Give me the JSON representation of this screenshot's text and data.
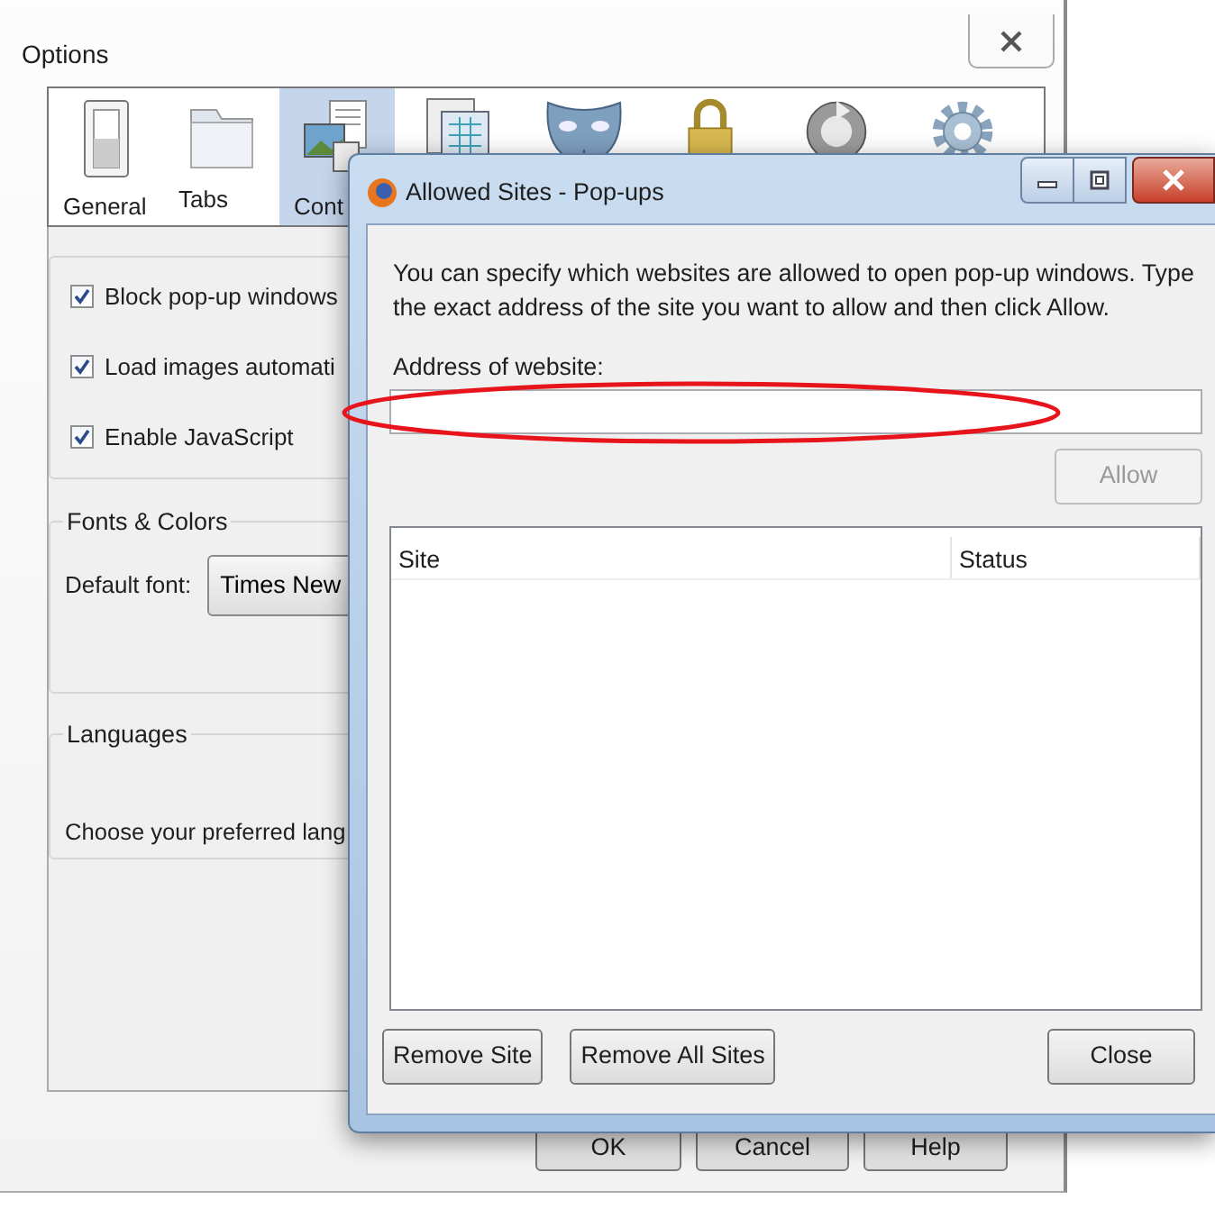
{
  "options_window": {
    "title": "Options",
    "toolbar": [
      {
        "kind": "general",
        "label": "General",
        "selected": false
      },
      {
        "kind": "tabs",
        "label": "Tabs",
        "selected": false
      },
      {
        "kind": "content",
        "label": "Cont",
        "selected": true
      },
      {
        "kind": "applications",
        "selected": false
      },
      {
        "kind": "privacy",
        "selected": false
      },
      {
        "kind": "security",
        "selected": false
      },
      {
        "kind": "sync",
        "selected": false
      },
      {
        "kind": "advanced",
        "selected": false
      }
    ],
    "checkboxes": [
      {
        "label": "Block pop-up windows",
        "checked": true
      },
      {
        "label": "Load images automati",
        "checked": true
      },
      {
        "label": "Enable JavaScript",
        "checked": true
      }
    ],
    "fonts_group": {
      "title": "Fonts & Colors",
      "default_font_label": "Default font:",
      "font_value": "Times New"
    },
    "languages_group": {
      "title": "Languages",
      "text": "Choose your preferred lang"
    },
    "buttons": [
      "OK",
      "Cancel",
      "Help"
    ]
  },
  "dialog": {
    "title": "Allowed Sites - Pop-ups",
    "description": "You can specify which websites are allowed to open pop-up windows. Type the exact address of the site you want to allow and then click Allow.",
    "address_label": "Address of website:",
    "allow_button": {
      "label": "Allow",
      "disabled": true
    },
    "columns": [
      "Site",
      "Status"
    ],
    "buttons": [
      "Remove Site",
      "Remove All Sites",
      "Close"
    ]
  }
}
